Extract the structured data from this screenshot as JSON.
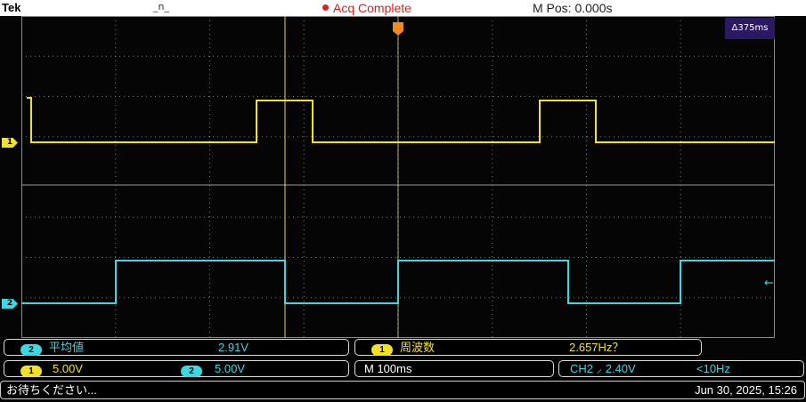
{
  "header": {
    "brand": "Tek",
    "trigger_state": "_n_",
    "acq_status": "Acq Complete",
    "m_pos": "M Pos: 0.000s"
  },
  "cursor": {
    "delta": "Δ375ms"
  },
  "channels": [
    {
      "marker": "1",
      "color": "#f2e12a"
    },
    {
      "marker": "2",
      "color": "#3ed6e0"
    }
  ],
  "measurements": {
    "m1": {
      "channel": "2",
      "name": "平均値",
      "value": "2.91V"
    },
    "m2": {
      "channel": "1",
      "name": "周波数",
      "value": "2.657Hz？"
    }
  },
  "scale": {
    "ch1_badge": "1",
    "ch1_volts": "5.00V",
    "ch2_badge": "2",
    "ch2_volts": "5.00V",
    "timebase": "M 100ms",
    "trigger": "CH2 ⸝ 2.40V",
    "trigger_freq": "<10Hz"
  },
  "status": {
    "message": "お待ちください...",
    "datetime": "Jun 30, 2025, 15:26"
  }
}
